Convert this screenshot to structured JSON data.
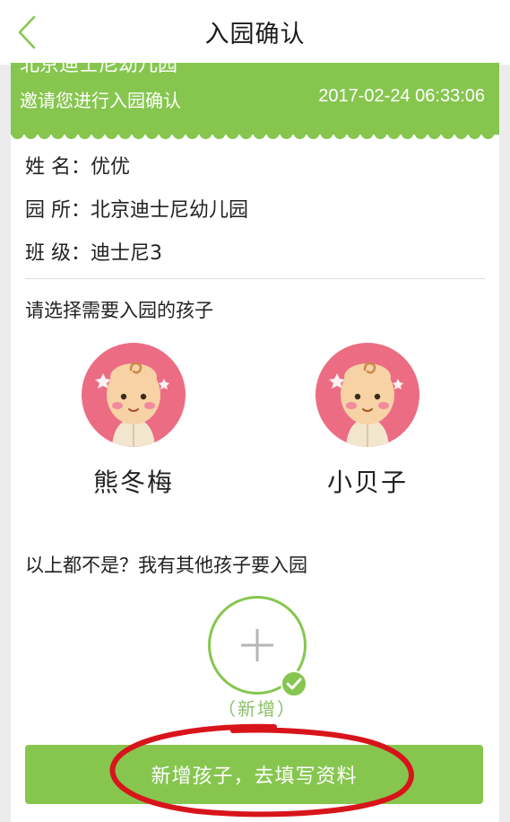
{
  "navbar": {
    "title": "入园确认",
    "back_icon": "chevron-left-icon"
  },
  "invite": {
    "school": "北京迪士尼幼儿园",
    "message": "邀请您进行入园确认",
    "timestamp": "2017-02-24 06:33:06"
  },
  "info": {
    "name_label": "姓  名：",
    "name_value": "优优",
    "school_label": "园  所：",
    "school_value": "北京迪士尼幼儿园",
    "class_label": "班  级：",
    "class_value": "迪士尼3"
  },
  "select_prompt": "请选择需要入园的孩子",
  "children": [
    {
      "name": "熊冬梅",
      "icon": "baby-avatar-icon"
    },
    {
      "name": "小贝子",
      "icon": "baby-avatar-icon"
    }
  ],
  "other_prompt": "以上都不是？我有其他孩子要入园",
  "add_child": {
    "label": "（新增）",
    "icon": "plus-icon",
    "badge_icon": "check-icon"
  },
  "submit_label": "新增孩子，去填写资料",
  "colors": {
    "accent": "#86c64f",
    "avatar_bg": "#ec6d83",
    "annotation": "#d8141b"
  }
}
